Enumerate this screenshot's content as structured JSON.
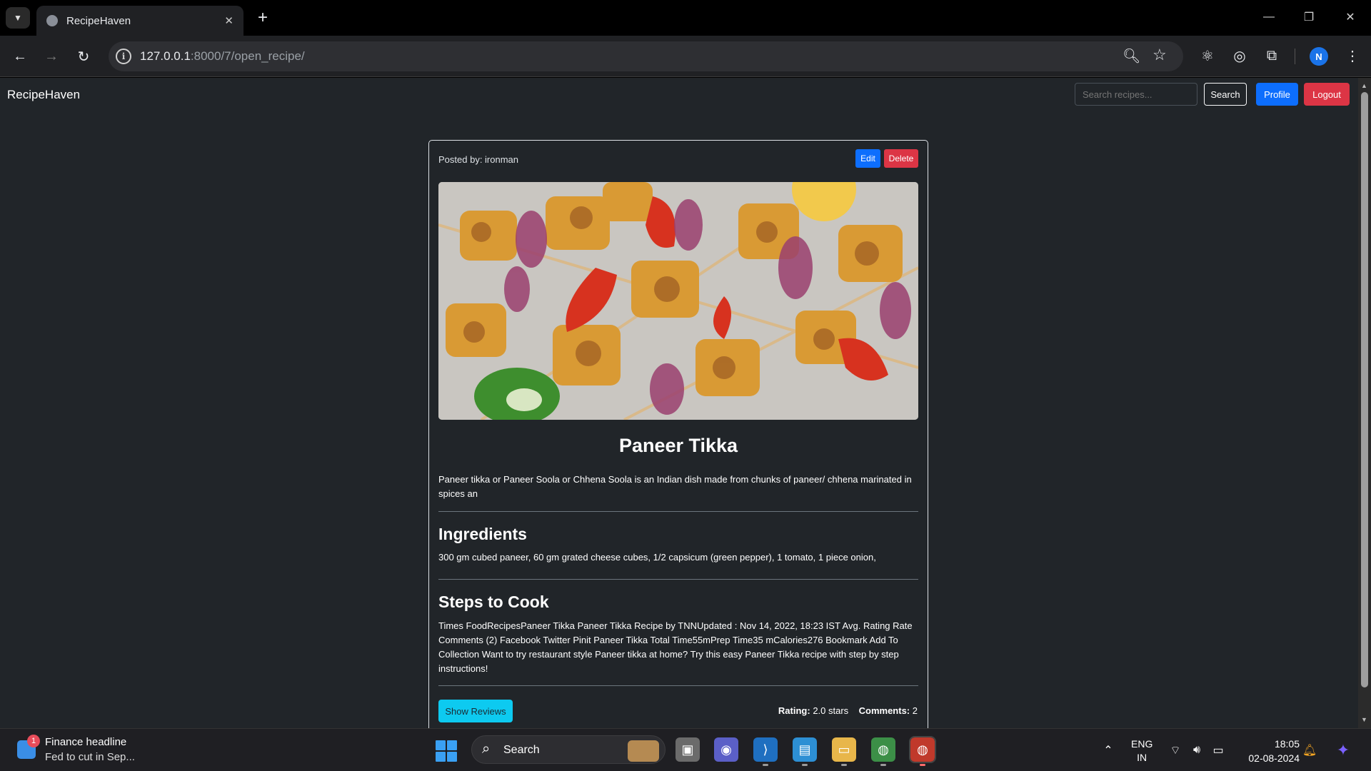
{
  "browser": {
    "tab_title": "RecipeHaven",
    "url_host": "127.0.0.1",
    "url_rest": ":8000/7/open_recipe/",
    "profile_initial": "N"
  },
  "navbar": {
    "brand": "RecipeHaven",
    "search_placeholder": "Search recipes...",
    "search_label": "Search",
    "profile_label": "Profile",
    "logout_label": "Logout"
  },
  "recipe": {
    "posted_by": "Posted by: ironman",
    "edit_label": "Edit",
    "delete_label": "Delete",
    "title": "Paneer Tikka",
    "description": "Paneer tikka or Paneer Soola or Chhena Soola is an Indian dish made from chunks of paneer/ chhena marinated in spices an",
    "ingredients_heading": "Ingredients",
    "ingredients": "300 gm cubed paneer, 60 gm grated cheese cubes, 1/2 capsicum (green pepper), 1 tomato, 1 piece onion,",
    "steps_heading": "Steps to Cook",
    "steps": "Times FoodRecipesPaneer Tikka Paneer Tikka Recipe by TNNUpdated : Nov 14, 2022, 18:23 IST Avg. Rating Rate Comments (2) Facebook Twitter Pinit Paneer Tikka Total Time55mPrep Time35 mCalories276 Bookmark Add To Collection Want to try restaurant style Paneer tikka at home? Try this easy Paneer Tikka recipe with step by step instructions!",
    "show_reviews_label": "Show Reviews",
    "rating_label": "Rating:",
    "rating_value": "2.0 stars",
    "comments_label": "Comments:",
    "comments_value": "2"
  },
  "taskbar": {
    "news_badge": "1",
    "news_title": "Finance headline",
    "news_subtitle": "Fed to cut in Sep...",
    "search_label": "Search",
    "lang_top": "ENG",
    "lang_bottom": "IN",
    "time": "18:05",
    "date": "02-08-2024"
  },
  "colors": {
    "page_bg": "#212529",
    "primary": "#0d6efd",
    "danger": "#dc3545",
    "info": "#0dcaf0"
  }
}
